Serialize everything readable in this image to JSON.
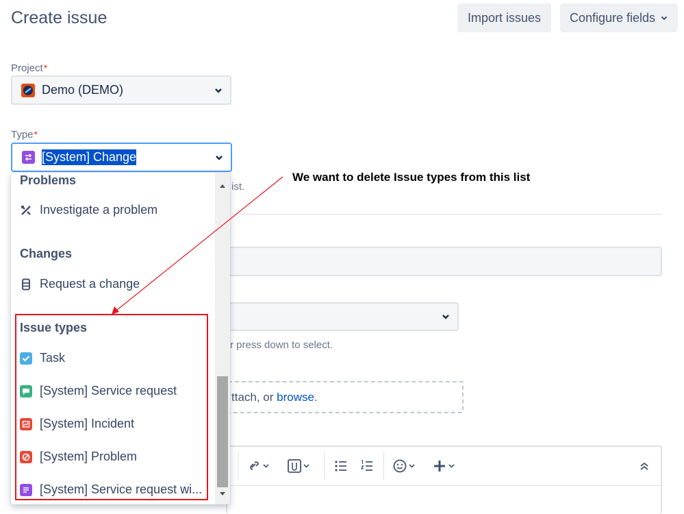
{
  "header": {
    "title": "Create issue",
    "import_label": "Import issues",
    "configure_label": "Configure fields"
  },
  "project": {
    "label": "Project",
    "required_mark": "*",
    "value": "Demo (DEMO)"
  },
  "type": {
    "label": "Type",
    "required_mark": "*",
    "value": "[System] Change",
    "hint_tail": "ist."
  },
  "background": {
    "press_down_hint": "r press down to select.",
    "attach_text": "ttach, or",
    "browse_link": "browse",
    "period": "."
  },
  "dropdown": {
    "groups": [
      {
        "name": "Problems",
        "items": [
          {
            "label": "Investigate a problem",
            "icon": "wrench-screwdriver-icon"
          }
        ]
      },
      {
        "name": "Changes",
        "items": [
          {
            "label": "Request a change",
            "icon": "server-icon"
          }
        ]
      },
      {
        "name": "Issue types",
        "items": [
          {
            "label": "Task",
            "icon": "task-checkbox-icon",
            "color": "#4bade8"
          },
          {
            "label": "[System] Service request",
            "icon": "service-request-icon",
            "color": "#36b37e"
          },
          {
            "label": "[System] Incident",
            "icon": "incident-icon",
            "color": "#e5493a"
          },
          {
            "label": "[System] Problem",
            "icon": "problem-icon",
            "color": "#e5493a"
          },
          {
            "label": "[System] Service request wi...",
            "icon": "service-request-approval-icon",
            "color": "#904ee2"
          }
        ]
      }
    ]
  },
  "annotation": {
    "note": "We want to delete Issue types from this list"
  },
  "colors": {
    "accent": "#4c9aff",
    "selection": "#0052cc",
    "change_icon": "#904ee2",
    "annotation_red": "#e8141d"
  }
}
